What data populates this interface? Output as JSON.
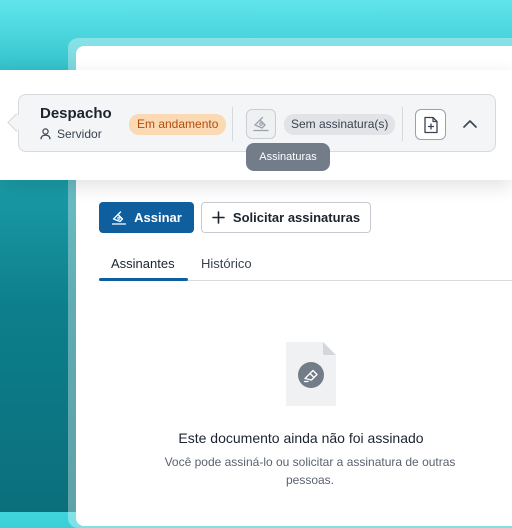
{
  "document": {
    "title": "Despacho",
    "role": "Servidor",
    "status_badge": "Em andamento",
    "signature_badge": "Sem assinatura(s)",
    "tooltip": "Assinaturas"
  },
  "actions": {
    "sign_label": "Assinar",
    "request_label": "Solicitar assinaturas"
  },
  "tabs": [
    {
      "label": "Assinantes",
      "active": true
    },
    {
      "label": "Histórico",
      "active": false
    }
  ],
  "empty_state": {
    "title": "Este documento ainda não foi assinado",
    "subtitle": "Você pode assiná-lo ou solicitar a assinatura de outras pessoas."
  },
  "colors": {
    "primary": "#0f5f9e",
    "badge_progress_bg": "#fad9b3",
    "badge_progress_text": "#b24d10",
    "tooltip_bg": "#737d89"
  },
  "icons": {
    "role": "user-icon",
    "signature": "signature-pen-icon",
    "add_document": "add-document-icon",
    "collapse": "chevron-up-icon",
    "request": "plus-icon",
    "empty": "document-signature-icon"
  }
}
